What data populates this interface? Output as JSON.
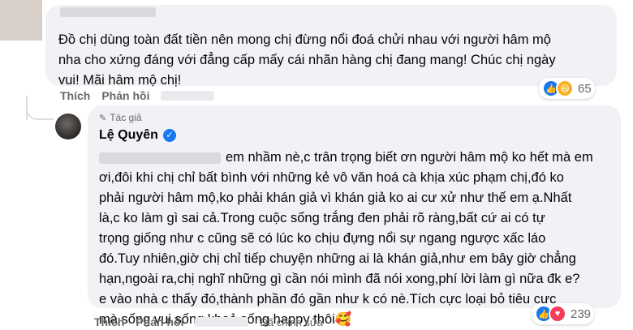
{
  "comment": {
    "text": "Đồ chị dùng toàn đất tiền nên mong chị đừng nổi đoá chửi nhau với người hâm mộ\nnha cho xứng đáng với đẳng cấp mấy cái nhãn hàng chị đang mang! Chúc chị ngày\nvui! Mãi hâm mộ chị!",
    "like_label": "Thích",
    "reply_label": "Phản hồi",
    "reactions": [
      "like-icon",
      "haha-icon"
    ],
    "reaction_count": "65"
  },
  "reply": {
    "badge_label": "Tác giả",
    "author_name": "Lệ Quyên",
    "text_first_line": "em nhầm nè,c trân trọng biết ơn người hâm mộ ko hết mà em",
    "text_rest": "ơi,đôi khi chị chỉ bất bình với những kẻ vô văn hoá cà khịa xúc phạm chị,đó ko\nphải người hâm mộ,ko phải khán giả vì khán giả ko ai cư xử như thế em ạ.Nhất\nlà,c ko làm gì sai cả.Trong cuộc sống trắng đen phải rõ ràng,bất cứ ai có tự\ntrọng giống như c cũng sẽ có lúc ko chịu đựng nổi sự ngang ngược xấc láo\nđó.Tuy nhiên,giờ chị chỉ tiếp chuyện những ai là khán giả,như em bây giờ chẳng\nhạn,ngoài ra,chị nghĩ những gì cần nói mình đã nói xong,phí lời làm gì nữa đk e?\ne vào nhà c thấy đó,thành phần đó gần như k có nè.Tích cực loại bỏ tiêu cực\nmà sống vui sống khoẻ sống happy thôi🥰",
    "like_label": "Thích",
    "reply_label": "Phản hồi",
    "edited_label": "Đã chỉnh sửa",
    "reactions": [
      "like-icon",
      "love-icon"
    ],
    "reaction_count": "239"
  },
  "colors": {
    "bubble": "#f0f2f5",
    "meta_text": "#65676b",
    "like_blue": "#1877f2",
    "haha_yellow": "#f7b125",
    "love_red": "#f33e58"
  }
}
